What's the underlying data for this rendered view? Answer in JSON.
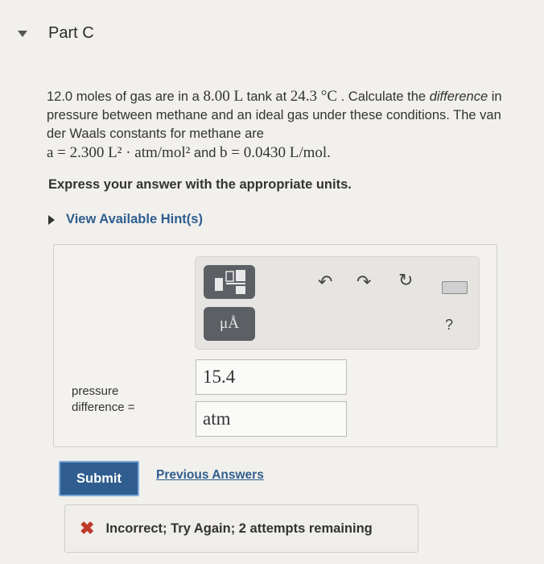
{
  "part": {
    "title": "Part C"
  },
  "question": {
    "line1_a": "12.0 moles of gas are in a ",
    "volume": "8.00 L",
    "line1_b": " tank at ",
    "temperature": "24.3 °C",
    "line1_c": " . Calculate the",
    "diff_word": "difference",
    "line2": " in pressure between methane and an ideal gas under these conditions. The van der Waals constants for methane are",
    "a_expr": "a = 2.300 L² · atm/mol²",
    "and_word": " and ",
    "b_expr": "b = 0.0430 L/mol."
  },
  "instruction": "Express your answer with the appropriate units.",
  "hint": {
    "label": "View Available Hint(s)"
  },
  "toolbar": {
    "units_label": "μÅ",
    "help_label": "?"
  },
  "answer": {
    "label": "pressure difference =",
    "value": "15.4",
    "unit": "atm"
  },
  "actions": {
    "submit_label": "Submit",
    "previous_answers_label": "Previous Answers"
  },
  "feedback": {
    "icon": "x-icon",
    "text": "Incorrect; Try Again; 2 attempts remaining",
    "color": "#c0392b"
  }
}
